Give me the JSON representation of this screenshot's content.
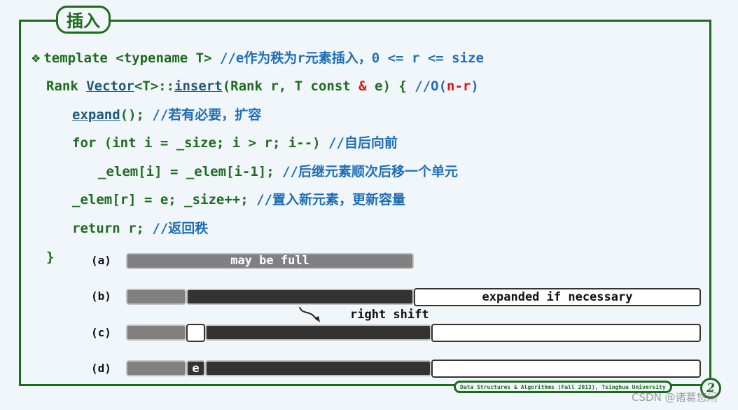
{
  "slide": {
    "title": "插入",
    "code_lines": [
      {
        "parts": [
          {
            "t": "template <typename T> ",
            "c": "code"
          },
          {
            "t": "//",
            "c": "cm"
          },
          {
            "t": "e作为秩为r元素插入，0 <= r <= size",
            "c": "cm"
          }
        ]
      },
      {
        "parts": [
          {
            "t": "Rank ",
            "c": "code"
          },
          {
            "t": "Vector",
            "c": "ul"
          },
          {
            "t": "<T>::",
            "c": "code"
          },
          {
            "t": "insert",
            "c": "ul"
          },
          {
            "t": "(Rank r, T const ",
            "c": "code"
          },
          {
            "t": "&",
            "c": "red"
          },
          {
            "t": " e) { ",
            "c": "code"
          },
          {
            "t": "//O(",
            "c": "cm"
          },
          {
            "t": "n-r",
            "c": "red"
          },
          {
            "t": ")",
            "c": "cm"
          }
        ]
      },
      {
        "parts": [
          {
            "t": "expand",
            "c": "ul"
          },
          {
            "t": "(); ",
            "c": "code"
          },
          {
            "t": "//若有必要，扩容",
            "c": "cm"
          }
        ]
      },
      {
        "parts": [
          {
            "t": "for (int i = _size; i > r; i--) ",
            "c": "code"
          },
          {
            "t": "//自后向前",
            "c": "cm"
          }
        ]
      },
      {
        "parts": [
          {
            "t": "_elem[i] = _elem[i-1]; ",
            "c": "code"
          },
          {
            "t": "//后继元素顺次后移一个单元",
            "c": "cm"
          }
        ]
      },
      {
        "parts": [
          {
            "t": "_elem[r] = e; _size++; ",
            "c": "code"
          },
          {
            "t": "//置入新元素，更新容量",
            "c": "cm"
          }
        ]
      },
      {
        "parts": [
          {
            "t": "return r; ",
            "c": "code"
          },
          {
            "t": "//返回秩",
            "c": "cm"
          }
        ]
      },
      {
        "parts": [
          {
            "t": "}",
            "c": "code"
          }
        ]
      }
    ],
    "diagram": {
      "labels": [
        "(a)",
        "(b)",
        "(c)",
        "(d)"
      ],
      "bar_a_text": "may be full",
      "bar_b_text": "expanded if necessary",
      "shift_text": "right shift",
      "inserted_element": "e"
    },
    "footer": "Data Structures & Algorithms (Fall 2013), Tsinghua University",
    "page_number": "2",
    "watermark": "CSDN @诸葛悠闲"
  }
}
